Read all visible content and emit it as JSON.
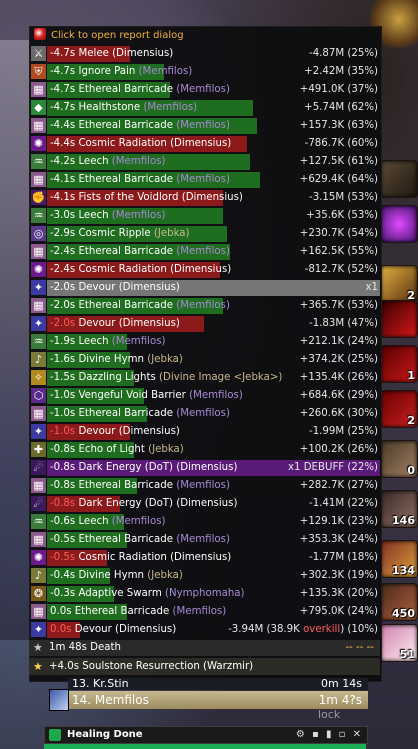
{
  "header": {
    "title": "Click to open report dialog",
    "icon": "shield-icon"
  },
  "rows": [
    {
      "time": "-4.7s",
      "spell": "Melee",
      "src": "Dimensius",
      "amount": "-4.87M",
      "pct": "(25%)",
      "color": "#8c1a1a",
      "fill": 0.25,
      "icon": "sword-icon"
    },
    {
      "time": "-4.7s",
      "spell": "Ignore Pain",
      "src": "Memfilos",
      "amount": "+2.42M",
      "pct": "(35%)",
      "color": "#1f6e1f",
      "fill": 0.35,
      "icon": "shield-icon"
    },
    {
      "time": "-4.7s",
      "spell": "Ethereal Barricade",
      "src": "Memfilos",
      "amount": "+491.0K",
      "pct": "(37%)",
      "color": "#1f6e1f",
      "fill": 0.37,
      "icon": "barricade-icon"
    },
    {
      "time": "-4.7s",
      "spell": "Healthstone",
      "src": "Memfilos",
      "amount": "+5.74M",
      "pct": "(62%)",
      "color": "#1f6e1f",
      "fill": 0.62,
      "icon": "healthstone-icon"
    },
    {
      "time": "-4.4s",
      "spell": "Ethereal Barricade",
      "src": "Memfilos",
      "amount": "+157.3K",
      "pct": "(63%)",
      "color": "#1f6e1f",
      "fill": 0.63,
      "icon": "barricade-icon"
    },
    {
      "time": "-4.4s",
      "spell": "Cosmic Radiation",
      "src": "Dimensius",
      "amount": "-786.7K",
      "pct": "(60%)",
      "color": "#8c1a1a",
      "fill": 0.6,
      "icon": "radiation-icon"
    },
    {
      "time": "-4.2s",
      "spell": "Leech",
      "src": "Memfilos",
      "amount": "+127.5K",
      "pct": "(61%)",
      "color": "#1f6e1f",
      "fill": 0.61,
      "icon": "leech-icon"
    },
    {
      "time": "-4.1s",
      "spell": "Ethereal Barricade",
      "src": "Memfilos",
      "amount": "+629.4K",
      "pct": "(64%)",
      "color": "#1f6e1f",
      "fill": 0.64,
      "icon": "barricade-icon"
    },
    {
      "time": "-4.1s",
      "spell": "Fists of the Voidlord",
      "src": "Dimensius",
      "amount": "-3.15M",
      "pct": "(53%)",
      "color": "#8c1a1a",
      "fill": 0.53,
      "icon": "void-fist-icon"
    },
    {
      "time": "-3.0s",
      "spell": "Leech",
      "src": "Memfilos",
      "amount": "+35.6K",
      "pct": "(53%)",
      "color": "#1f6e1f",
      "fill": 0.53,
      "icon": "leech-icon"
    },
    {
      "time": "-2.9s",
      "spell": "Cosmic Ripple",
      "src": "Jebka",
      "amount": "+230.7K",
      "pct": "(54%)",
      "color": "#1f6e1f",
      "fill": 0.54,
      "icon": "ripple-icon"
    },
    {
      "time": "-2.4s",
      "spell": "Ethereal Barricade",
      "src": "Memfilos",
      "amount": "+162.5K",
      "pct": "(55%)",
      "color": "#1f6e1f",
      "fill": 0.55,
      "icon": "barricade-icon"
    },
    {
      "time": "-2.4s",
      "spell": "Cosmic Radiation",
      "src": "Dimensius",
      "amount": "-812.7K",
      "pct": "(52%)",
      "color": "#8c1a1a",
      "fill": 0.52,
      "icon": "radiation-icon"
    },
    {
      "time": "-2.0s",
      "spell": "Devour",
      "src": "Dimensius",
      "amount": "x1",
      "pct": "",
      "color": "#767676",
      "fill": 1.0,
      "icon": "devour-icon",
      "highlight": true
    },
    {
      "time": "-2.0s",
      "spell": "Ethereal Barricade",
      "src": "Memfilos",
      "amount": "+365.7K",
      "pct": "(53%)",
      "color": "#1f6e1f",
      "fill": 0.53,
      "icon": "barricade-icon"
    },
    {
      "time": "-2.0s",
      "spell": "Devour",
      "src": "Dimensius",
      "amount": "-1.83M",
      "pct": "(47%)",
      "color": "#8c1a1a",
      "fill": 0.47,
      "icon": "devour-icon",
      "timeRed": true
    },
    {
      "time": "-1.9s",
      "spell": "Leech",
      "src": "Memfilos",
      "amount": "+212.1K",
      "pct": "(24%)",
      "color": "#1f6e1f",
      "fill": 0.24,
      "icon": "leech-icon"
    },
    {
      "time": "-1.6s",
      "spell": "Divine Hymn",
      "src": "Jebka",
      "amount": "+374.2K",
      "pct": "(25%)",
      "color": "#1f6e1f",
      "fill": 0.25,
      "icon": "hymn-icon"
    },
    {
      "time": "-1.5s",
      "spell": "Dazzling Lights",
      "src": "Divine Image <Jebka>",
      "amount": "+135.4K",
      "pct": "(26%)",
      "color": "#1f6e1f",
      "fill": 0.26,
      "icon": "lights-icon"
    },
    {
      "time": "-1.0s",
      "spell": "Vengeful Void Barrier",
      "src": "Memfilos",
      "amount": "+684.6K",
      "pct": "(29%)",
      "color": "#1f6e1f",
      "fill": 0.29,
      "icon": "void-barrier-icon"
    },
    {
      "time": "-1.0s",
      "spell": "Ethereal Barricade",
      "src": "Memfilos",
      "amount": "+260.6K",
      "pct": "(30%)",
      "color": "#1f6e1f",
      "fill": 0.3,
      "icon": "barricade-icon"
    },
    {
      "time": "-1.0s",
      "spell": "Devour",
      "src": "Dimensius",
      "amount": "-1.99M",
      "pct": "(25%)",
      "color": "#8c1a1a",
      "fill": 0.25,
      "icon": "devour-icon",
      "timeRed": true
    },
    {
      "time": "-0.8s",
      "spell": "Echo of Light",
      "src": "Jebka",
      "amount": "+100.2K",
      "pct": "(26%)",
      "color": "#1f6e1f",
      "fill": 0.26,
      "icon": "echo-icon"
    },
    {
      "time": "-0.8s",
      "spell": "Dark Energy (DoT)",
      "src": "Dimensius",
      "amount": "x1 DEBUFF",
      "pct": "(22%)",
      "color": "#5a1a78",
      "fill": 1.0,
      "icon": "dark-energy-icon",
      "debuff": true
    },
    {
      "time": "-0.8s",
      "spell": "Ethereal Barricade",
      "src": "Memfilos",
      "amount": "+282.7K",
      "pct": "(27%)",
      "color": "#1f6e1f",
      "fill": 0.27,
      "icon": "barricade-icon"
    },
    {
      "time": "-0.8s",
      "spell": "Dark Energy (DoT)",
      "src": "Dimensius",
      "amount": "-1.41M",
      "pct": "(22%)",
      "color": "#8c1a1a",
      "fill": 0.22,
      "icon": "dark-energy-icon",
      "timeRed": true
    },
    {
      "time": "-0.6s",
      "spell": "Leech",
      "src": "Memfilos",
      "amount": "+129.1K",
      "pct": "(23%)",
      "color": "#1f6e1f",
      "fill": 0.23,
      "icon": "leech-icon"
    },
    {
      "time": "-0.5s",
      "spell": "Ethereal Barricade",
      "src": "Memfilos",
      "amount": "+353.3K",
      "pct": "(24%)",
      "color": "#1f6e1f",
      "fill": 0.24,
      "icon": "barricade-icon"
    },
    {
      "time": "-0.5s",
      "spell": "Cosmic Radiation",
      "src": "Dimensius",
      "amount": "-1.77M",
      "pct": "(18%)",
      "color": "#8c1a1a",
      "fill": 0.18,
      "icon": "radiation-icon",
      "timeRed": true
    },
    {
      "time": "-0.4s",
      "spell": "Divine Hymn",
      "src": "Jebka",
      "amount": "+302.3K",
      "pct": "(19%)",
      "color": "#1f6e1f",
      "fill": 0.19,
      "icon": "hymn-icon"
    },
    {
      "time": "-0.3s",
      "spell": "Adaptive Swarm",
      "src": "Nymphomaha",
      "amount": "+135.3K",
      "pct": "(20%)",
      "color": "#1f6e1f",
      "fill": 0.2,
      "icon": "swarm-icon"
    },
    {
      "time": "0.0s",
      "spell": "Ethereal Barricade",
      "src": "Memfilos",
      "amount": "+795.0K",
      "pct": "(24%)",
      "color": "#1f6e1f",
      "fill": 0.24,
      "icon": "barricade-icon"
    },
    {
      "time": "0.0s",
      "spell": "Devour",
      "src": "Dimensius",
      "amount": "-3.94M (38.9K overkill)",
      "pct": "(10%)",
      "color": "#8c1a1a",
      "fill": 0.1,
      "icon": "devour-icon",
      "timeRed": true,
      "overkill": true
    }
  ],
  "death": {
    "label": "1m 48s Death",
    "right": "-- -- --",
    "icon": "star-icon"
  },
  "rez": {
    "label": "+4.0s Soulstone Resurrection (Warzmir)",
    "icon": "star-icon"
  },
  "meter": {
    "row13": {
      "rank": "13.",
      "name": "Kr.Stin",
      "time": "0m 14s"
    },
    "row14": {
      "rank": "14.",
      "name": "Memfilos",
      "time": "1m 4?s"
    },
    "lock_label": "lock",
    "section": "Healing Done"
  },
  "actionbar_counts": [
    "",
    "",
    "2",
    "",
    "1",
    "2",
    "0",
    "146",
    "134",
    "450",
    "51"
  ]
}
